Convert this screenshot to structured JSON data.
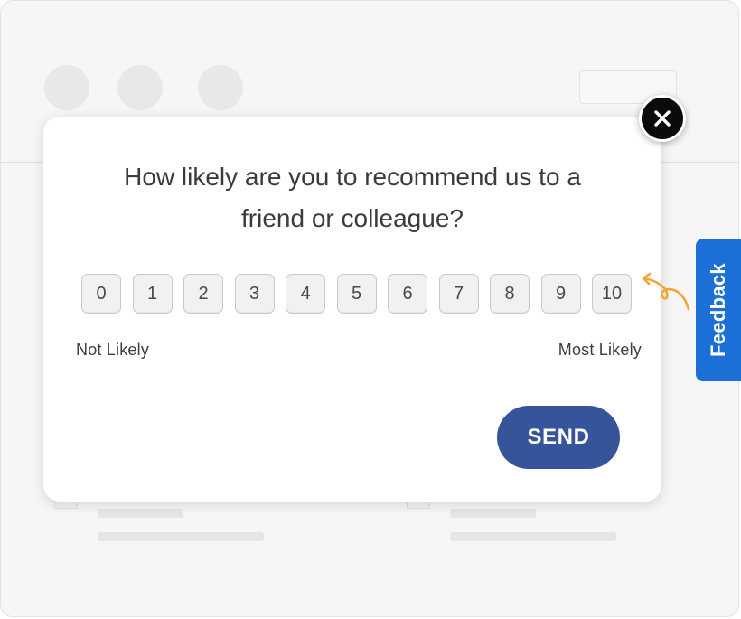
{
  "survey": {
    "question_line1": "How likely are you to recommend us to a",
    "question_line2": "friend or colleague?",
    "scores": [
      "0",
      "1",
      "2",
      "3",
      "4",
      "5",
      "6",
      "7",
      "8",
      "9",
      "10"
    ],
    "low_label": "Not Likely",
    "high_label": "Most Likely",
    "send_label": "SEND"
  },
  "feedback_tab": {
    "label": "Feedback"
  },
  "icons": {
    "close": "close-icon",
    "arrow": "curved-arrow-icon"
  },
  "colors": {
    "send_button": "#35549a",
    "feedback_tab": "#1b6fd6",
    "close_button": "#0b0b0b",
    "arrow": "#f2a531"
  }
}
